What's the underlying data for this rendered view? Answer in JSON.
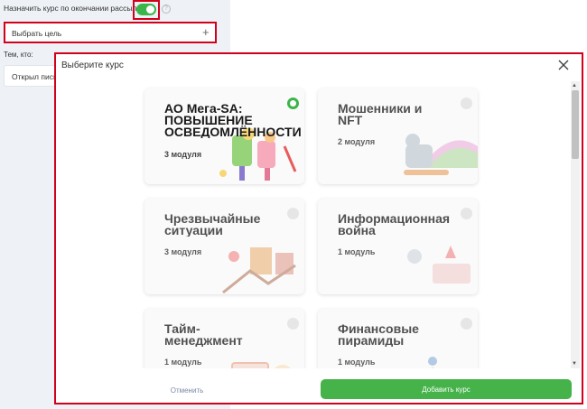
{
  "form": {
    "assign_label": "Назначить курс по окончании рассылки",
    "goal_label": "Выбрать цель",
    "who_label": "Тем, кто:",
    "opened_label": "Открыл письмо"
  },
  "modal": {
    "title": "Выберите курс",
    "cancel_label": "Отменить",
    "add_label": "Добавить курс",
    "courses": [
      {
        "title": "АО Мега-SA:\nПОВЫШЕНИЕ\nОСВЕДОМЛЁННОСТИ",
        "modules": "3 модуля",
        "selected": true
      },
      {
        "title": "Мошенники и\nNFT",
        "modules": "2 модуля",
        "selected": false
      },
      {
        "title": "Чрезвычайные\nситуации",
        "modules": "3 модуля",
        "selected": false
      },
      {
        "title": "Информационная\nвойна",
        "modules": "1 модуль",
        "selected": false
      },
      {
        "title": "Тайм-\nменеджмент",
        "modules": "1 модуль",
        "selected": false
      },
      {
        "title": "Финансовые\nпирамиды",
        "modules": "1 модуль",
        "selected": false
      }
    ]
  },
  "colors": {
    "accent": "#45b24a",
    "highlight": "#d0021b"
  },
  "icons": {
    "close": "close-icon",
    "plus": "plus-icon",
    "help": "help-icon"
  }
}
